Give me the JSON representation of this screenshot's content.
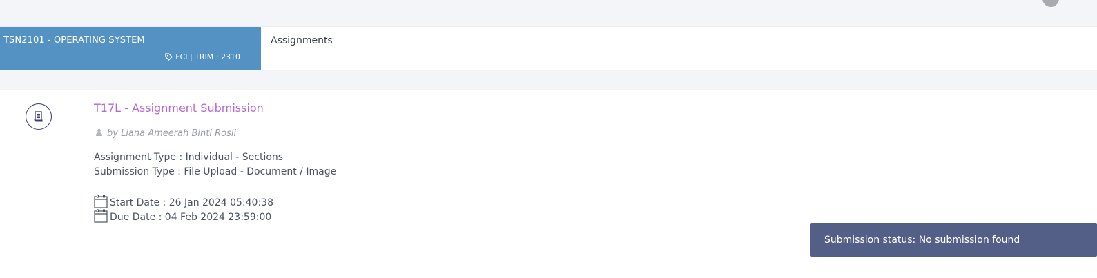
{
  "course": {
    "name": "TSN2101 - OPERATING SYSTEM",
    "meta": "FCI | TRIM : 2310",
    "color": "#5592c4"
  },
  "breadcrumb": {
    "current": "Assignments"
  },
  "assignment": {
    "title": "T17L - Assignment Submission",
    "title_color": "#b36ad8",
    "author": "by Liana Ameerah Binti Rosli",
    "assignment_type": "Assignment Type : Individual - Sections",
    "submission_type": "Submission Type : File Upload - Document / Image",
    "start_date": "Start Date : 26 Jan 2024 05:40:38",
    "due_date": "Due Date : 04 Feb 2024 23:59:00"
  },
  "status": {
    "text": "Submission status: No submission found",
    "color": "#535f87"
  },
  "icons": {
    "tag": "tag-icon",
    "document": "document-icon",
    "user": "user-icon",
    "calendar": "calendar-icon",
    "avatar": "user-avatar-icon"
  }
}
